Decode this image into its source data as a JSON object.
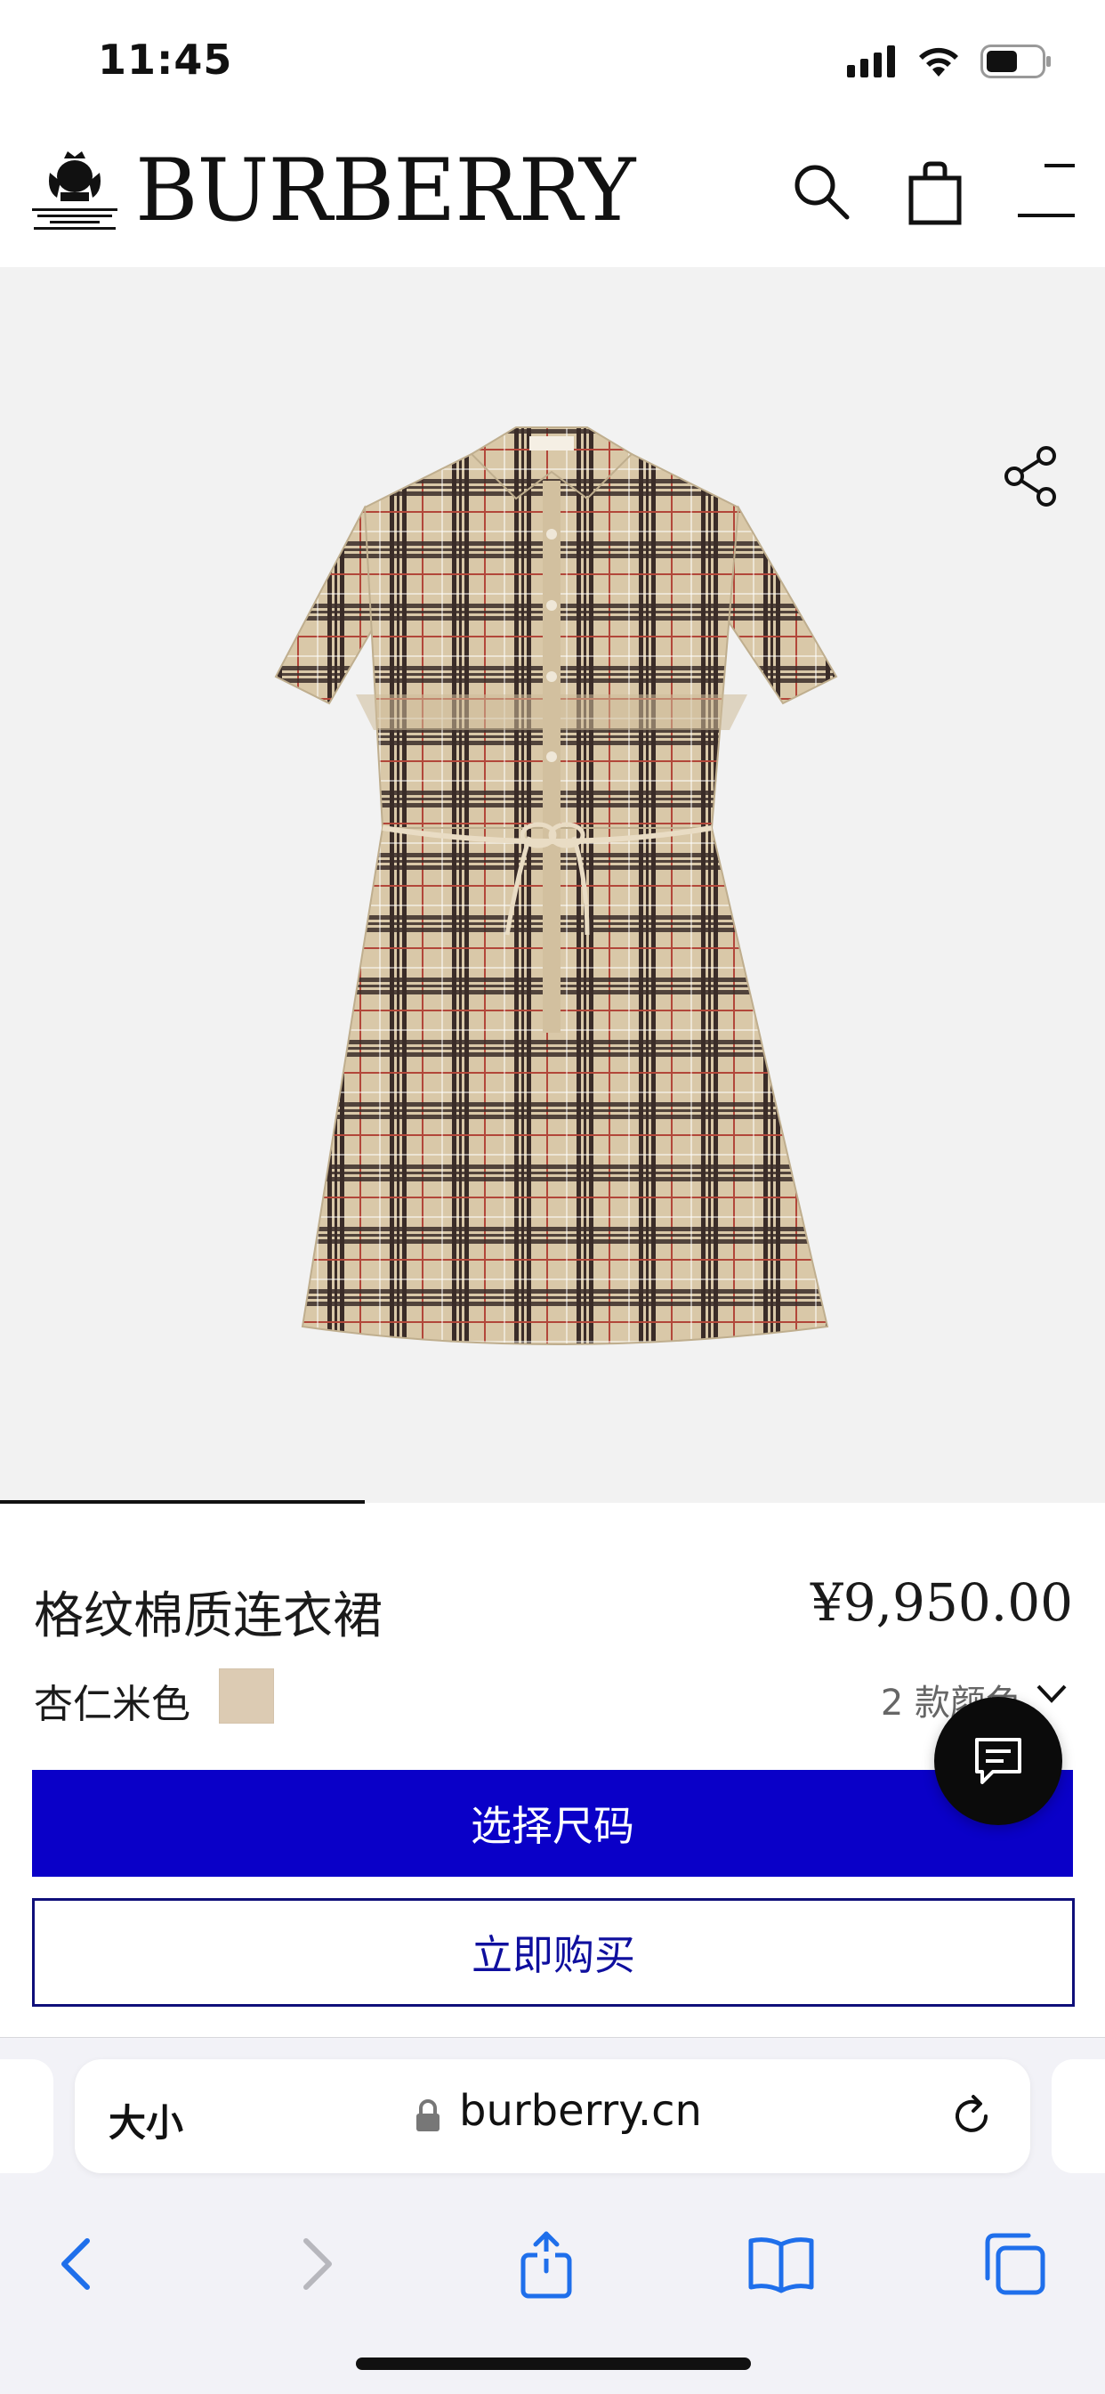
{
  "status_bar": {
    "time": "11:45"
  },
  "header": {
    "brand": "BURBERRY",
    "crest_caption": "BY APPOINTMENT TO HER MAJESTY THE QUEEN OUTFITTERS BURBERRY LIMITED LONDON"
  },
  "product": {
    "name": "格纹棉质连衣裙",
    "price": "¥9,950.00",
    "color_name": "杏仁米色",
    "color_hex": "#dccbb3",
    "color_count": "2 款颜色",
    "select_size_label": "选择尺码",
    "buy_now_label": "立即购买"
  },
  "hero": {
    "image_index": 1,
    "image_count": 3
  },
  "browser": {
    "text_size_label": "大小",
    "url": "burberry.cn"
  },
  "colors": {
    "primary_button": "#0a00c8",
    "secondary_border": "#0f0f7a",
    "hero_bg": "#f2f2f2"
  },
  "icons": [
    "search-icon",
    "bag-icon",
    "menu-icon",
    "share-icon",
    "chevron-down-icon",
    "chat-icon",
    "lock-icon",
    "reload-icon",
    "back-icon",
    "forward-icon",
    "share-sheet-icon",
    "bookmarks-icon",
    "tabs-icon"
  ]
}
